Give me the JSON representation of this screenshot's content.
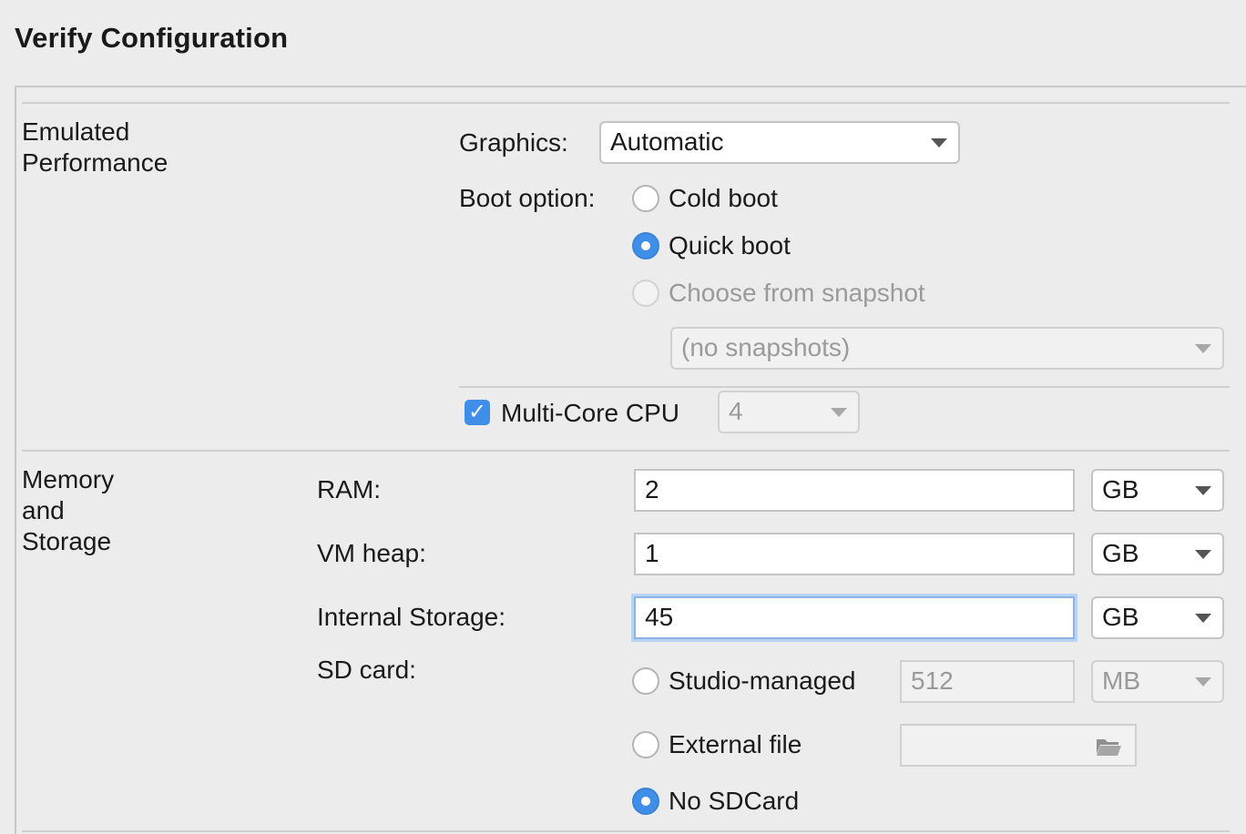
{
  "header": {
    "title": "Verify Configuration"
  },
  "emulated_performance": {
    "section_label_line1": "Emulated",
    "section_label_line2": "Performance",
    "graphics_label": "Graphics:",
    "graphics_value": "Automatic",
    "boot_option_label": "Boot option:",
    "boot_options": [
      {
        "label": "Cold boot",
        "selected": false,
        "enabled": true
      },
      {
        "label": "Quick boot",
        "selected": true,
        "enabled": true
      },
      {
        "label": "Choose from snapshot",
        "selected": false,
        "enabled": false
      }
    ],
    "snapshot_value": "(no snapshots)",
    "multicore_label": "Multi-Core CPU",
    "multicore_checked": true,
    "multicore_value": "4"
  },
  "memory_storage": {
    "section_label_line1": "Memory",
    "section_label_line2": "and",
    "section_label_line3": "Storage",
    "ram_label": "RAM:",
    "ram_value": "2",
    "ram_unit": "GB",
    "vm_heap_label": "VM heap:",
    "vm_heap_value": "1",
    "vm_heap_unit": "GB",
    "internal_storage_label": "Internal Storage:",
    "internal_storage_value": "45",
    "internal_storage_unit": "GB",
    "sd_card_label": "SD card:",
    "sd_options": [
      {
        "label": "Studio-managed",
        "selected": false
      },
      {
        "label": "External file",
        "selected": false
      },
      {
        "label": "No SDCard",
        "selected": true
      }
    ],
    "studio_managed_size": "512",
    "studio_managed_unit": "MB"
  },
  "colors": {
    "accent": "#3f8fe8",
    "focus_ring": "#b8d4f5"
  }
}
